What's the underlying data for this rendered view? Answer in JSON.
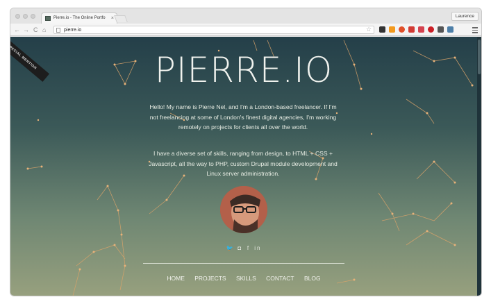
{
  "browser": {
    "tab_title": "Pierre.io - The Online Portfo",
    "tab_close": "×",
    "user_name": "Laurence",
    "url": "pierre.io",
    "nav_back": "←",
    "nav_forward": "→",
    "nav_reload": "C",
    "nav_home": "⌂",
    "star": "☆"
  },
  "page": {
    "ribbon": "SPECIAL MENTION",
    "title": "PIERRE.IO",
    "intro": "Hello! My name is Pierre Nel, and I'm a London-based freelancer. If I'm not freelancing at some of London's finest digital agencies, I'm working remotely on projects for clients all over the world.",
    "skills": "I have a diverse set of skills, ranging from design, to HTML + CSS + Javascript, all the way to PHP, custom Drupal module development and Linux server administration.",
    "social": [
      "twitter-icon",
      "instagram-icon",
      "facebook-icon",
      "linkedin-icon"
    ],
    "social_glyphs": [
      "🐦",
      "◘",
      "f",
      "in"
    ],
    "nav": [
      "HOME",
      "PROJECTS",
      "SKILLS",
      "CONTACT",
      "BLOG"
    ]
  },
  "colors": {
    "bg_top": "#243f49",
    "bg_bottom": "#97a07e",
    "lines": "#d9a36a"
  }
}
